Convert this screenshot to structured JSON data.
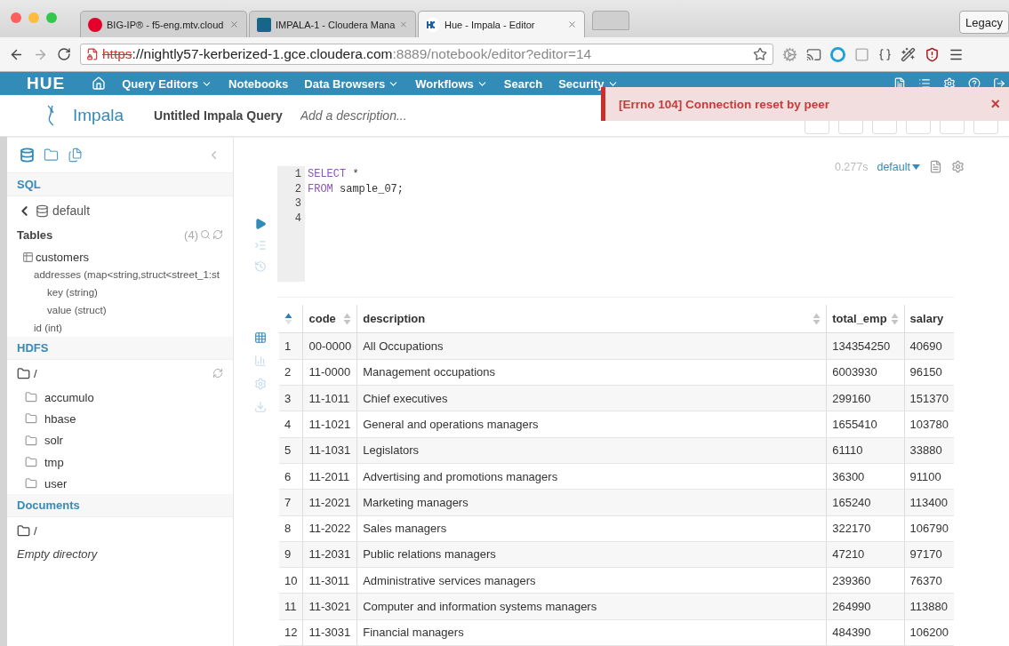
{
  "browser": {
    "tabs": [
      {
        "title": "BIG-IP® - f5-eng.mtv.cloud",
        "selected": false,
        "kind": "f5"
      },
      {
        "title": "IMPALA-1 - Cloudera Mana",
        "selected": false,
        "kind": "cloudera"
      },
      {
        "title": "Hue - Impala - Editor",
        "selected": true,
        "kind": "hue"
      }
    ],
    "profile_button": "Legacy",
    "url": {
      "scheme": "https",
      "rest": "://nightly57-kerberized-1.gce.cloudera.com",
      "port": ":8889/notebook/editor?editor=14"
    }
  },
  "nav": {
    "logo": "HUE",
    "items": [
      {
        "label": "Query Editors",
        "dropdown": true
      },
      {
        "label": "Notebooks",
        "dropdown": false
      },
      {
        "label": "Data Browsers",
        "dropdown": true
      },
      {
        "label": "Workflows",
        "dropdown": true
      },
      {
        "label": "Search",
        "dropdown": false
      },
      {
        "label": "Security",
        "dropdown": true
      }
    ]
  },
  "header": {
    "app": "Impala",
    "title": "Untitled Impala Query",
    "description_placeholder": "Add a description..."
  },
  "alert": {
    "message": "[Errno 104] Connection reset by peer",
    "close": "×"
  },
  "sidebar": {
    "panels": [
      {
        "kind": "database",
        "selected": true
      },
      {
        "kind": "folder",
        "selected": false
      },
      {
        "kind": "documents",
        "selected": false
      }
    ],
    "sql": {
      "heading": "SQL",
      "database": "default",
      "tables_label": "Tables",
      "tables_count": "(4)",
      "tree": [
        {
          "label": "customers",
          "children": [
            {
              "label": "addresses (map<string,struct<street_1:st",
              "children": [
                {
                  "label": "key (string)"
                },
                {
                  "label": "value (struct)"
                }
              ]
            },
            {
              "label": "id (int)"
            }
          ]
        }
      ]
    },
    "hdfs": {
      "heading": "HDFS",
      "root": "/",
      "folders": [
        "accumulo",
        "hbase",
        "solr",
        "tmp",
        "user"
      ]
    },
    "documents": {
      "heading": "Documents",
      "root": "/",
      "empty": "Empty directory"
    }
  },
  "editor": {
    "elapsed": "0.277s",
    "database": "default",
    "actions": [
      {
        "kind": "run",
        "disabled": false
      },
      {
        "kind": "format",
        "disabled": true
      },
      {
        "kind": "history",
        "disabled": true
      }
    ],
    "lines": [
      {
        "number": "1",
        "tokens": [
          {
            "kind": "keyword",
            "text": "SELECT"
          },
          {
            "kind": "plain",
            "text": " *"
          }
        ]
      },
      {
        "number": "2",
        "tokens": [
          {
            "kind": "keyword",
            "text": "FROM"
          },
          {
            "kind": "plain",
            "text": " sample_07;"
          }
        ]
      },
      {
        "number": "3"
      },
      {
        "number": "4"
      }
    ]
  },
  "results": {
    "actions": [
      {
        "kind": "grid",
        "disabled": false
      },
      {
        "kind": "chart",
        "disabled": true
      },
      {
        "kind": "settings",
        "disabled": true
      },
      {
        "kind": "download",
        "disabled": true
      }
    ],
    "columns": [
      {
        "sorted": true
      },
      {
        "label": "code",
        "sorted": false
      },
      {
        "label": "description",
        "sorted": false
      },
      {
        "label": "total_emp",
        "sorted": false
      },
      {
        "label": "salary"
      }
    ],
    "rows": [
      [
        "1",
        "00-0000",
        "All Occupations",
        "134354250",
        "40690"
      ],
      [
        "2",
        "11-0000",
        "Management occupations",
        "6003930",
        "96150"
      ],
      [
        "3",
        "11-1011",
        "Chief executives",
        "299160",
        "151370"
      ],
      [
        "4",
        "11-1021",
        "General and operations managers",
        "1655410",
        "103780"
      ],
      [
        "5",
        "11-1031",
        "Legislators",
        "61110",
        "33880"
      ],
      [
        "6",
        "11-2011",
        "Advertising and promotions managers",
        "36300",
        "91100"
      ],
      [
        "7",
        "11-2021",
        "Marketing managers",
        "165240",
        "113400"
      ],
      [
        "8",
        "11-2022",
        "Sales managers",
        "322170",
        "106790"
      ],
      [
        "9",
        "11-2031",
        "Public relations managers",
        "47210",
        "97170"
      ],
      [
        "10",
        "11-3011",
        "Administrative services managers",
        "239360",
        "76370"
      ],
      [
        "11",
        "11-3021",
        "Computer and information systems managers",
        "264990",
        "113880"
      ],
      [
        "12",
        "11-3031",
        "Financial managers",
        "484390",
        "106200"
      ]
    ]
  }
}
